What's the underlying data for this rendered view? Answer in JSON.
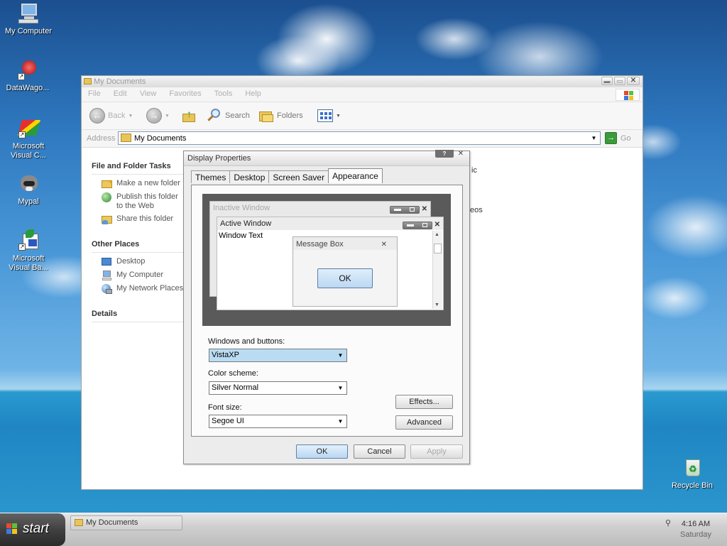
{
  "desktop": {
    "icons": [
      {
        "label": "My Computer"
      },
      {
        "label": "DataWago..."
      },
      {
        "label": "Microsoft Visual C..."
      },
      {
        "label": "Mypal"
      },
      {
        "label": "Microsoft Visual Ba..."
      },
      {
        "label": "Recycle Bin"
      }
    ]
  },
  "explorer": {
    "title": "My Documents",
    "menu": [
      "File",
      "Edit",
      "View",
      "Favorites",
      "Tools",
      "Help"
    ],
    "toolbar": {
      "back": "Back",
      "search": "Search",
      "folders": "Folders"
    },
    "address": {
      "label": "Address",
      "value": "My Documents",
      "go": "Go"
    },
    "file_tasks": {
      "heading": "File and Folder Tasks",
      "items": [
        "Make a new folder",
        "Publish this folder to the Web",
        "Share this folder"
      ]
    },
    "other_places": {
      "heading": "Other Places",
      "items": [
        "Desktop",
        "My Computer",
        "My Network Places"
      ]
    },
    "details": {
      "heading": "Details"
    },
    "partial_text": [
      "ic",
      "eos"
    ]
  },
  "dialog": {
    "title": "Display Properties",
    "help": "?",
    "close": "✕",
    "tabs": [
      "Themes",
      "Desktop",
      "Screen Saver",
      "Appearance"
    ],
    "active_tab": "Appearance",
    "preview": {
      "inactive_window": "Inactive Window",
      "active_window": "Active Window",
      "window_text": "Window Text",
      "message_box": "Message Box",
      "ok": "OK"
    },
    "windows_buttons": {
      "label": "Windows and buttons:",
      "value": "VistaXP"
    },
    "color_scheme": {
      "label": "Color scheme:",
      "value": "Silver Normal"
    },
    "font_size": {
      "label": "Font size:",
      "value": "Segoe UI"
    },
    "effects": "Effects...",
    "advanced": "Advanced",
    "ok": "OK",
    "cancel": "Cancel",
    "apply": "Apply"
  },
  "taskbar": {
    "start": "start",
    "task": "My Documents",
    "time": "4:16 AM",
    "day": "Saturday"
  },
  "colors": {
    "accent": "#5a7fa6",
    "selection": "#b9dcf3",
    "start": "#3e3e3e"
  }
}
